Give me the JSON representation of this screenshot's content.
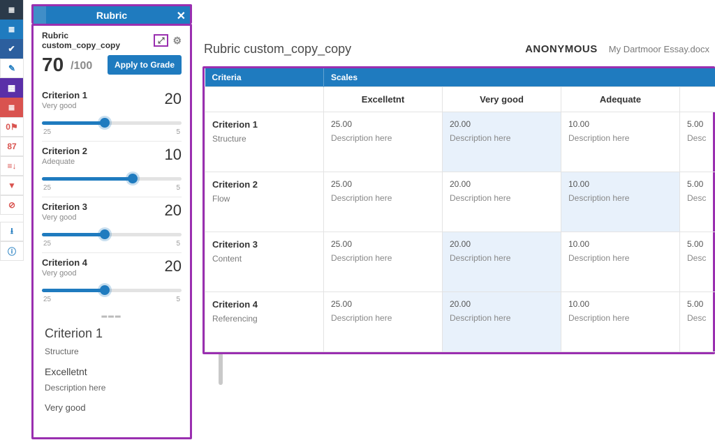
{
  "rail": {
    "items": [
      {
        "name": "layers-icon",
        "cls": "dark",
        "glyph": "≣"
      },
      {
        "name": "layers2-icon",
        "cls": "blue",
        "glyph": "≣"
      },
      {
        "name": "check-icon",
        "cls": "blue2",
        "glyph": "✔"
      },
      {
        "name": "edit-icon",
        "cls": "white",
        "glyph": "✎"
      },
      {
        "name": "grid-icon",
        "cls": "purpleSel",
        "glyph": "▦"
      },
      {
        "name": "stack-icon",
        "cls": "red",
        "glyph": "≣"
      },
      {
        "name": "flag-count",
        "cls": "whiteRed",
        "glyph": "0⚑"
      },
      {
        "name": "similarity-count",
        "cls": "whiteRed",
        "glyph": "87"
      },
      {
        "name": "bars-icon",
        "cls": "whiteRed",
        "glyph": "≡↓"
      },
      {
        "name": "funnel-icon",
        "cls": "whiteRed",
        "glyph": "▼"
      },
      {
        "name": "block-icon",
        "cls": "whiteRed",
        "glyph": "⊘"
      },
      {
        "name": "gap",
        "cls": "gap",
        "glyph": ""
      },
      {
        "name": "download-icon",
        "cls": "white",
        "glyph": "⭳"
      },
      {
        "name": "info-icon",
        "cls": "white",
        "glyph": "ⓘ"
      }
    ]
  },
  "panel": {
    "header_label": "Rubric",
    "title": "Rubric custom_copy_copy",
    "score": "70",
    "score_denom": "/100",
    "apply_label": "Apply to Grade",
    "tick_left": "25",
    "tick_right": "5",
    "criteria": [
      {
        "name": "Criterion 1",
        "levelLabel": "Very good",
        "score": "20",
        "fillPct": 45
      },
      {
        "name": "Criterion 2",
        "levelLabel": "Adequate",
        "score": "10",
        "fillPct": 65
      },
      {
        "name": "Criterion 3",
        "levelLabel": "Very good",
        "score": "20",
        "fillPct": 45
      },
      {
        "name": "Criterion 4",
        "levelLabel": "Very good",
        "score": "20",
        "fillPct": 45
      }
    ],
    "detail": {
      "heading": "Criterion 1",
      "sub": "Structure",
      "level_name": "Excelletnt",
      "level_desc": "Description here",
      "next_level": "Very good"
    }
  },
  "main": {
    "title": "Rubric custom_copy_copy",
    "anonymous_label": "ANONYMOUS",
    "filename": "My Dartmoor Essay.docx",
    "axis_criteria": "Criteria",
    "axis_scales": "Scales",
    "scales": [
      "Excelletnt",
      "Very good",
      "Adequate",
      ""
    ],
    "desc_placeholder": "Description here",
    "desc_short": "Desc",
    "rows": [
      {
        "name": "Criterion 1",
        "sub": "Structure",
        "pts": [
          "25.00",
          "20.00",
          "10.00",
          "5.00"
        ],
        "sel": 1
      },
      {
        "name": "Criterion 2",
        "sub": "Flow",
        "pts": [
          "25.00",
          "20.00",
          "10.00",
          "5.00"
        ],
        "sel": 2
      },
      {
        "name": "Criterion 3",
        "sub": "Content",
        "pts": [
          "25.00",
          "20.00",
          "10.00",
          "5.00"
        ],
        "sel": 1
      },
      {
        "name": "Criterion 4",
        "sub": "Referencing",
        "pts": [
          "25.00",
          "20.00",
          "10.00",
          "5.00"
        ],
        "sel": 1
      }
    ]
  }
}
